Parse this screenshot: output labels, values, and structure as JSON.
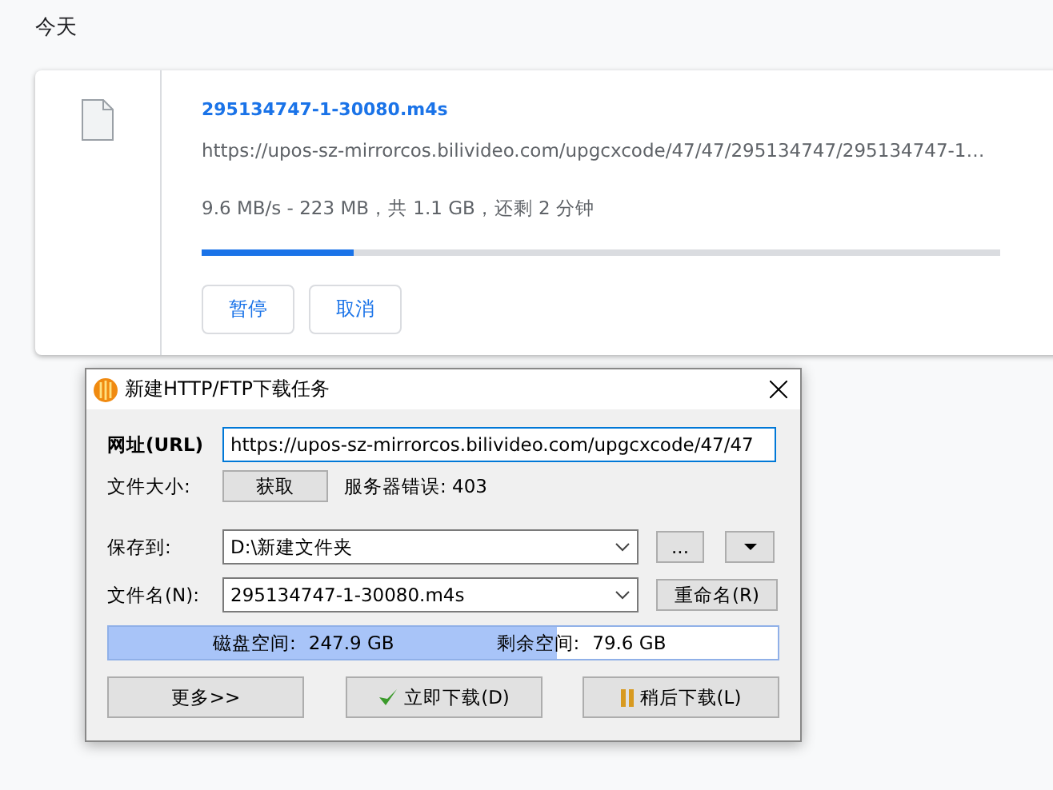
{
  "section_title": "今天",
  "download": {
    "file_name": "295134747-1-30080.m4s",
    "url": "https://upos-sz-mirrorcos.bilivideo.com/upgcxcode/47/47/295134747/295134747-1…",
    "status": "9.6 MB/s - 223 MB，共 1.1 GB，还剩 2 分钟",
    "level": 0.19,
    "buttons": [
      "暂停",
      "取消"
    ]
  },
  "dialog": {
    "title": "新建HTTP/FTP下载任务",
    "url_label": "网址(URL)",
    "url_value": "https://upos-sz-mirrorcos.bilivideo.com/upgcxcode/47/47",
    "size_label": "文件大小:",
    "fetch_button": "获取",
    "size_status": "服务器错误: 403",
    "save_label": "保存到:",
    "save_value": "D:\\新建文件夹",
    "browse_button": "...",
    "name_label": "文件名(N):",
    "name_value": "295134747-1-30080.m4s",
    "rename_button": "重命名(R)",
    "disk": {
      "level": 0.67,
      "total_label": "磁盘空间:",
      "total_value": "247.9 GB",
      "free_label": "剩余空间:",
      "free_value": "79.6 GB"
    },
    "buttons": [
      {
        "kind": "more",
        "label": "更多>>"
      },
      {
        "kind": "now",
        "label": "立即下载(D)"
      },
      {
        "kind": "later",
        "label": "稍后下载(L)"
      }
    ]
  }
}
